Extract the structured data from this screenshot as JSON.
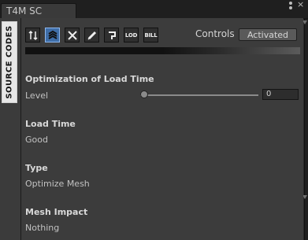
{
  "window": {
    "tab_title": "T4M SC"
  },
  "sidebar": {
    "logo_text": "SOURCE CODES"
  },
  "toolbar": {
    "tools": [
      {
        "name": "tool-1",
        "label": "",
        "icon": "vertical-arrows-icon"
      },
      {
        "name": "tool-2",
        "label": "",
        "icon": "stacked-chevrons-icon"
      },
      {
        "name": "tool-3",
        "label": "",
        "icon": "tools-icon"
      },
      {
        "name": "tool-4",
        "label": "",
        "icon": "pencil-icon"
      },
      {
        "name": "tool-5",
        "label": "",
        "icon": "paint-icon"
      },
      {
        "name": "tool-6",
        "label": "LOD",
        "icon": "lod-icon"
      },
      {
        "name": "tool-7",
        "label": "BILL",
        "icon": "bill-icon"
      }
    ],
    "controls_label": "Controls",
    "activated_label": "Activated"
  },
  "optimization": {
    "title": "Optimization of Load Time",
    "level_label": "Level",
    "level_value": "0",
    "level_fraction": 0
  },
  "load_time": {
    "title": "Load Time",
    "value": "Good"
  },
  "type": {
    "title": "Type",
    "value": "Optimize Mesh"
  },
  "mesh_impact": {
    "title": "Mesh Impact",
    "value": "Nothing"
  },
  "colors": {
    "accent": "#3f6ea8",
    "panel": "#3c3c3c",
    "text": "#c2c2c2"
  }
}
